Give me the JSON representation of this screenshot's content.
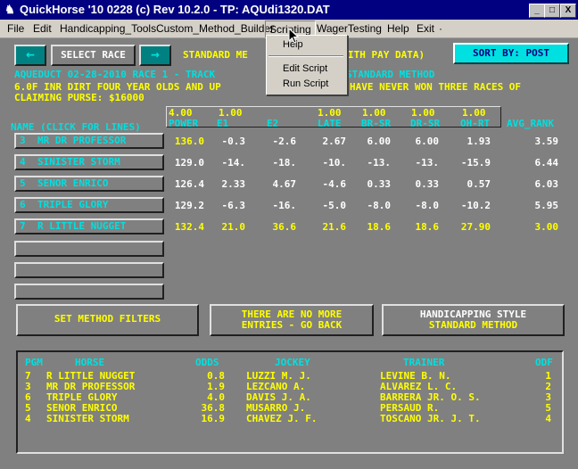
{
  "window": {
    "title": "QuickHorse '10 0228 (c) Rev 10.2.0 - TP: AQUdi1320.DAT",
    "buttons": [
      "_",
      "□",
      "X"
    ]
  },
  "menubar": [
    "File",
    "Edit",
    "Handicapping_Tools",
    "Custom_Method_Builder",
    "Scripting",
    "WagerTesting",
    "Help",
    "Exit"
  ],
  "menu_tail": "·",
  "dropdown": {
    "open_menu": "Scripting",
    "items": [
      "Help",
      "Edit Script",
      "Run Script"
    ]
  },
  "toolbar": {
    "prev_label": "←",
    "select_race_label": "SELECT RACE",
    "next_label": "→",
    "method_label": "STANDARD ME",
    "method_label_tail": "ITH PAY DATA)",
    "sort_label": "SORT BY: POST"
  },
  "race_info": {
    "line1a": "AQUEDUCT 02-28-2010 RACE 1 - TRACK",
    "line1b": "STANDARD METHOD",
    "line2a": "6.0F INR DIRT FOUR YEAR OLDS AND UP",
    "line2b": "HAVE NEVER WON THREE RACES OF",
    "line3": "CLAIMING  PURSE: $16000"
  },
  "columns": {
    "name_header": "NAME (CLICK FOR LINES)",
    "weights": [
      "4.00",
      "1.00",
      "",
      "1.00",
      "1.00",
      "1.00",
      "1.00",
      ""
    ],
    "headers": [
      "POWER",
      "E1",
      "E2",
      "LATE",
      "BR-SR",
      "DR-SR",
      "OH-RT",
      "AVG_RANK"
    ]
  },
  "horses": [
    {
      "pp": "3",
      "name": "MR DR PROFESSOR",
      "power": "136.0",
      "e1": "-0.3",
      "e2": "-2.6",
      "late": "2.67",
      "brsr": "6.00",
      "drsr": "6.00",
      "ohrt": "1.93",
      "avg": "3.59"
    },
    {
      "pp": "4",
      "name": "SINISTER STORM",
      "power": "129.0",
      "e1": "-14.",
      "e2": "-18.",
      "late": "-10.",
      "brsr": "-13.",
      "drsr": "-13.",
      "ohrt": "-15.9",
      "avg": "6.44"
    },
    {
      "pp": "5",
      "name": "SENOR ENRICO",
      "power": "126.4",
      "e1": "2.33",
      "e2": "4.67",
      "late": "-4.6",
      "brsr": "0.33",
      "drsr": "0.33",
      "ohrt": "0.57",
      "avg": "6.03"
    },
    {
      "pp": "6",
      "name": "TRIPLE GLORY",
      "power": "129.2",
      "e1": "-6.3",
      "e2": "-16.",
      "late": "-5.0",
      "brsr": "-8.0",
      "drsr": "-8.0",
      "ohrt": "-10.2",
      "avg": "5.95"
    },
    {
      "pp": "7",
      "name": "R LITTLE NUGGET",
      "power": "132.4",
      "e1": "21.0",
      "e2": "36.6",
      "late": "21.6",
      "brsr": "18.6",
      "drsr": "18.6",
      "ohrt": "27.90",
      "avg": "3.00"
    }
  ],
  "buttons": {
    "set_filters": "SET METHOD FILTERS",
    "no_more_1": "THERE ARE NO MORE",
    "no_more_2": "ENTRIES - GO BACK",
    "style_1": "HANDICAPPING STYLE",
    "style_2": "STANDARD METHOD"
  },
  "entries": {
    "headers": [
      "PGM",
      "HORSE",
      "ODDS",
      "JOCKEY",
      "TRAINER",
      "ODF"
    ],
    "rows": [
      {
        "pgm": "7",
        "horse": "R LITTLE NUGGET",
        "odds": "0.8",
        "jockey": "LUZZI M. J.",
        "trainer": "LEVINE B. N.",
        "odf": "1"
      },
      {
        "pgm": "3",
        "horse": "MR DR PROFESSOR",
        "odds": "1.9",
        "jockey": "LEZCANO A.",
        "trainer": "ALVAREZ L. C.",
        "odf": "2"
      },
      {
        "pgm": "6",
        "horse": "TRIPLE GLORY",
        "odds": "4.0",
        "jockey": "DAVIS J. A.",
        "trainer": "BARRERA JR. O. S.",
        "odf": "3"
      },
      {
        "pgm": "5",
        "horse": "SENOR ENRICO",
        "odds": "36.8",
        "jockey": "MUSARRO J.",
        "trainer": "PERSAUD R.",
        "odf": "5"
      },
      {
        "pgm": "4",
        "horse": "SINISTER STORM",
        "odds": "16.9",
        "jockey": "CHAVEZ J. F.",
        "trainer": "TOSCANO JR. J. T.",
        "odf": "4"
      }
    ]
  },
  "colors": {
    "cyan": "#00e0e0",
    "yellow": "#ffff00",
    "teal": "#008080",
    "titlebar": "#000080"
  }
}
